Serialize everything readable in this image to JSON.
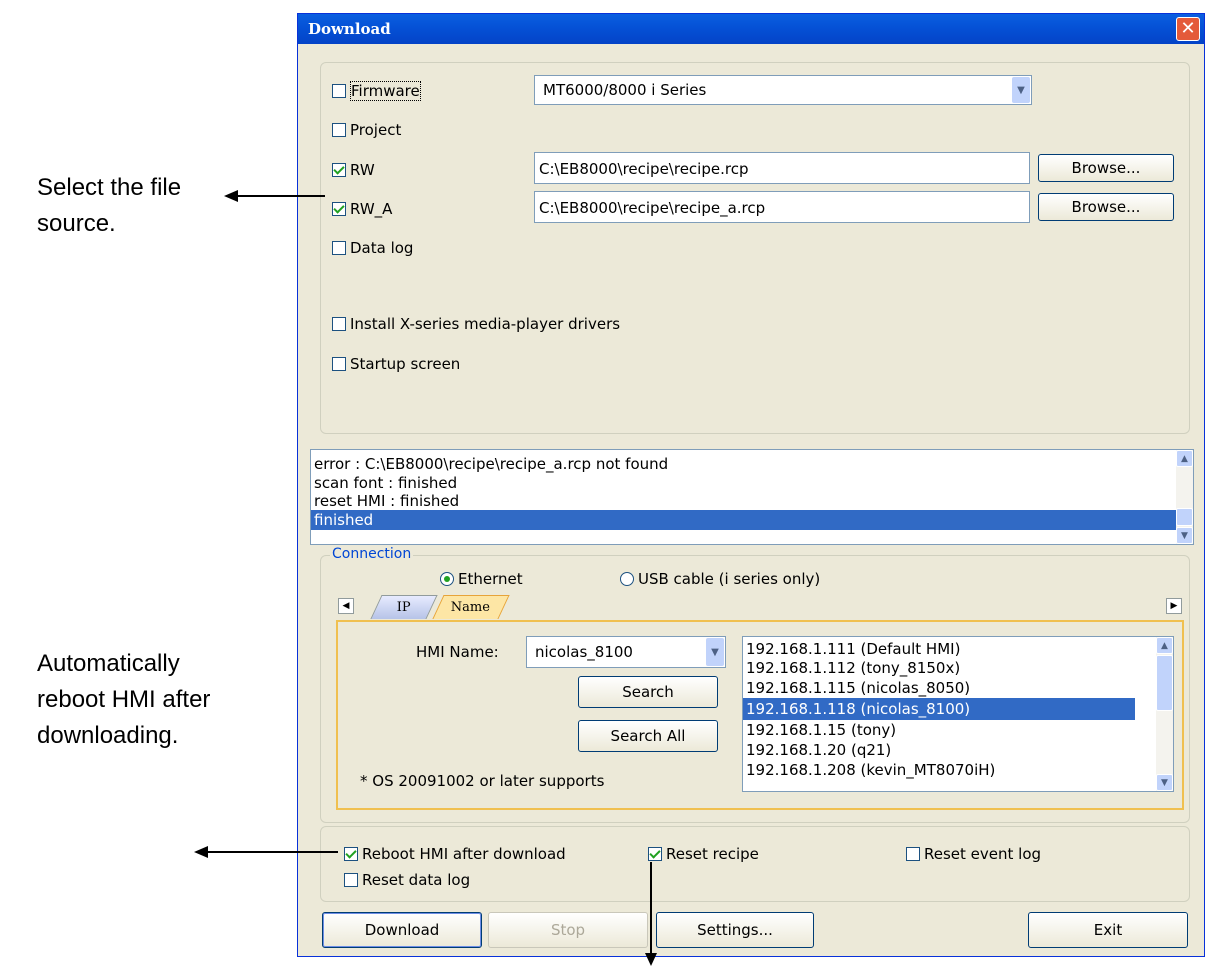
{
  "annotations": {
    "file_source": [
      "Select the file",
      "source."
    ],
    "reboot": [
      "Automatically",
      "reboot HMI after",
      "downloading."
    ]
  },
  "dialog": {
    "title": "Download",
    "close_glyph": "✕",
    "files": {
      "firmware_label": "Firmware",
      "firmware_checked": false,
      "series_value": "MT6000/8000 i Series",
      "project_label": "Project",
      "project_checked": false,
      "rw_label": "RW",
      "rw_checked": true,
      "rw_path": "C:\\EB8000\\recipe\\recipe.rcp",
      "rw_a_label": "RW_A",
      "rw_a_checked": true,
      "rw_a_path": "C:\\EB8000\\recipe\\recipe_a.rcp",
      "browse_label": "Browse...",
      "data_log_label": "Data log",
      "data_log_checked": false,
      "media_label": "Install X-series media-player drivers",
      "media_checked": false,
      "startup_label": "Startup screen",
      "startup_checked": false
    },
    "log": [
      "error : C:\\EB8000\\recipe\\recipe_a.rcp not found",
      "scan font : finished",
      "reset HMI : finished",
      "finished"
    ],
    "log_selected_index": 3,
    "connection": {
      "legend": "Connection",
      "ethernet_label": "Ethernet",
      "ethernet_selected": true,
      "usb_label": "USB cable (i series only)",
      "tabs": [
        "IP",
        "Name"
      ],
      "active_tab": "Name",
      "hmi_name_label": "HMI Name:",
      "hmi_name_value": "nicolas_8100",
      "search_label": "Search",
      "search_all_label": "Search All",
      "note": "* OS 20091002 or later supports",
      "hmi_list": [
        "192.168.1.111 (Default HMI)",
        "192.168.1.112 (tony_8150x)",
        "192.168.1.115 (nicolas_8050)",
        "192.168.1.118 (nicolas_8100)",
        "192.168.1.15 (tony)",
        "192.168.1.20 (q21)",
        "192.168.1.208 (kevin_MT8070iH)"
      ],
      "hmi_selected_index": 3
    },
    "options": {
      "reboot_label": "Reboot HMI after download",
      "reboot_checked": true,
      "reset_recipe_label": "Reset recipe",
      "reset_recipe_checked": true,
      "reset_event_label": "Reset event log",
      "reset_event_checked": false,
      "reset_data_label": "Reset data log",
      "reset_data_checked": false
    },
    "buttons": {
      "download": "Download",
      "stop": "Stop",
      "settings": "Settings...",
      "exit": "Exit"
    }
  },
  "colors": {
    "title_bar": "#0551d6",
    "selection": "#316ac5",
    "checkmark": "#21a121",
    "dialog_bg": "#ece9d8"
  }
}
